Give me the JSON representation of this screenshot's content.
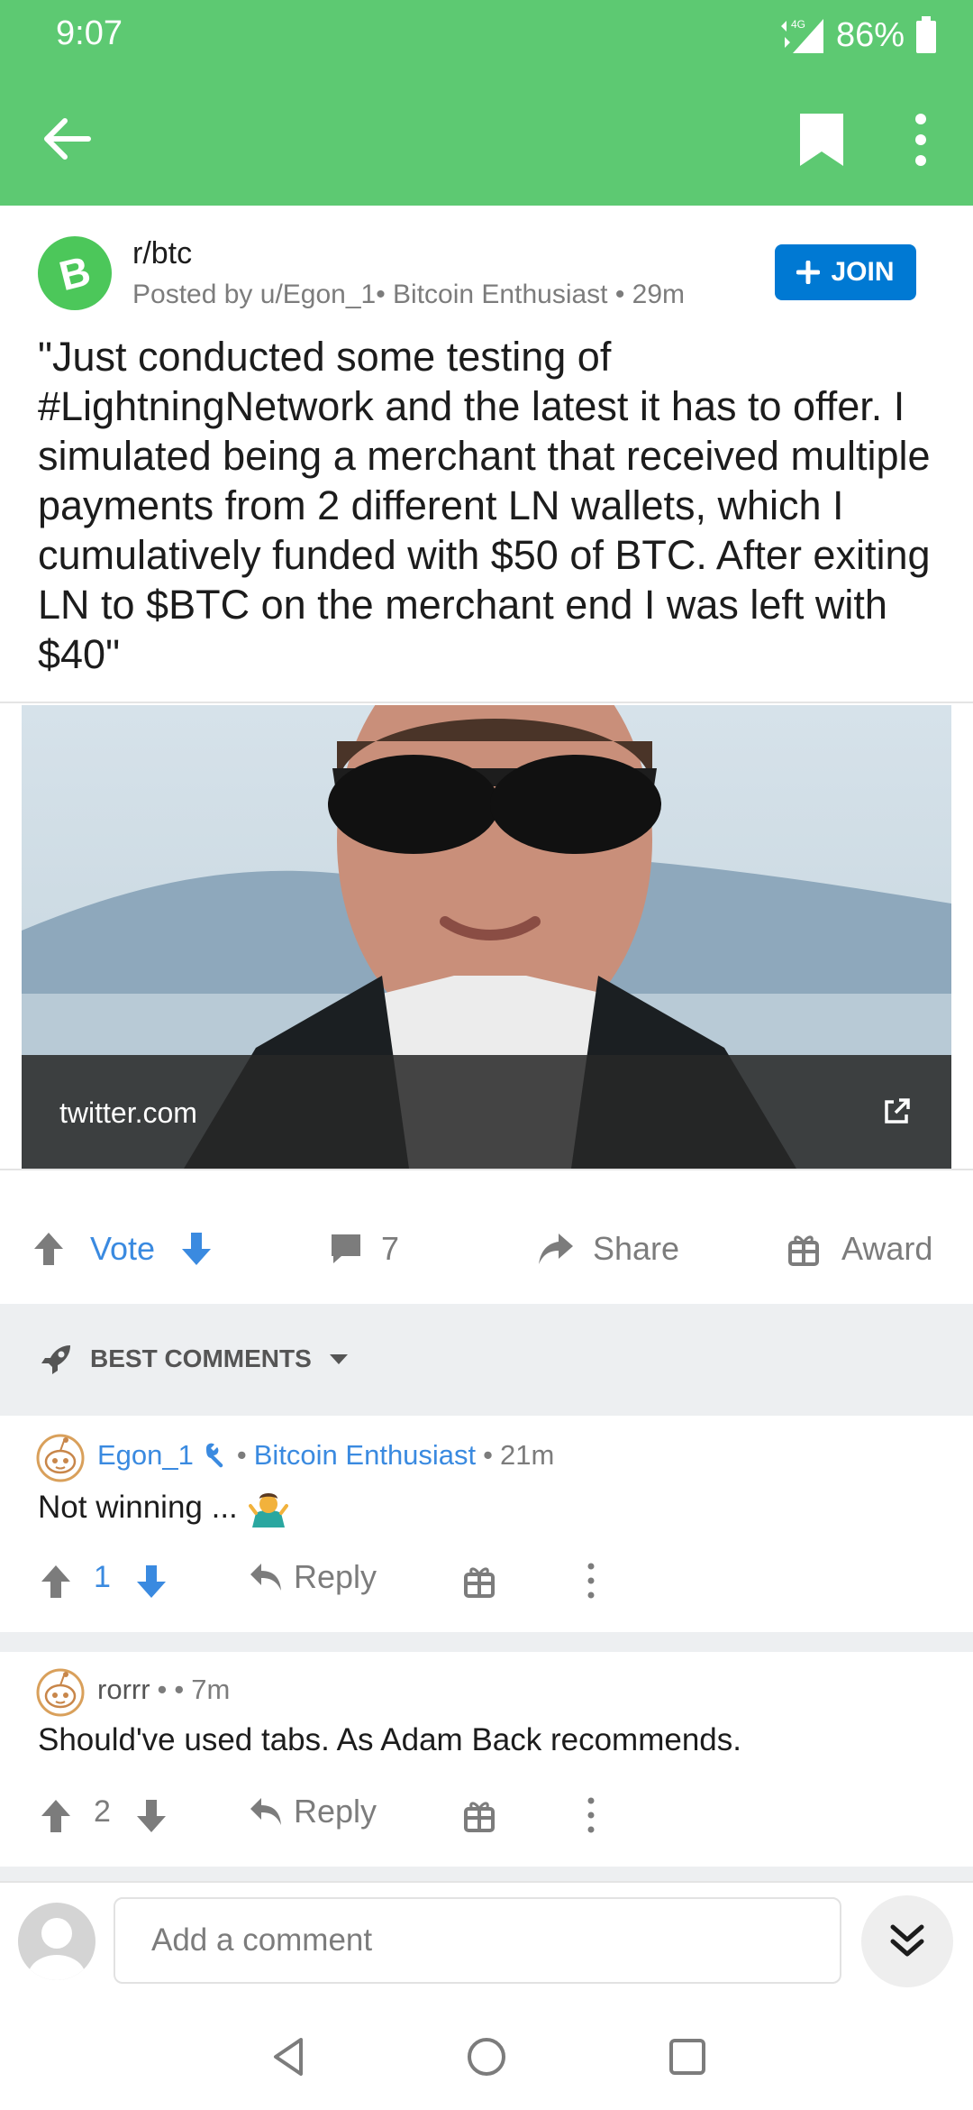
{
  "status": {
    "time": "9:07",
    "network": "4G",
    "battery": "86%"
  },
  "colors": {
    "app_green": "#5dc972",
    "join_blue": "#0079d3",
    "link_blue": "#3a8ae0"
  },
  "post": {
    "subreddit": "r/btc",
    "posted_by": "Posted by u/Egon_1• Bitcoin Enthusiast • 29m",
    "join_label": "JOIN",
    "title": "\"Just conducted some testing of #LightningNetwork and the latest it has to offer. I simulated being a merchant that received multiple payments from 2 different LN wallets, which I cumulatively funded with $50 of BTC. After exiting LN to $BTC on the merchant end I was left with $40\"",
    "link_domain": "twitter.com"
  },
  "actions": {
    "vote": "Vote",
    "comments": "7",
    "share": "Share",
    "award": "Award"
  },
  "sort": {
    "label": "BEST COMMENTS"
  },
  "comments": [
    {
      "author": "Egon_1",
      "flair": "Bitcoin Enthusiast",
      "age": "21m",
      "body": "Not winning ...",
      "score": "1",
      "reply": "Reply"
    },
    {
      "author": "rorrr",
      "age": "7m",
      "body": "Should've used tabs. As Adam Back recommends.",
      "score": "2",
      "reply": "Reply"
    }
  ],
  "composer": {
    "placeholder": "Add a comment"
  },
  "icons": [
    "back-arrow-icon",
    "bookmark-icon",
    "more-vert-icon",
    "bitcoin-cash-icon",
    "plus-icon",
    "external-link-icon",
    "upvote-icon",
    "downvote-icon",
    "comment-icon",
    "share-icon",
    "gift-icon",
    "rocket-icon",
    "caret-down-icon",
    "snoo-avatar-icon",
    "mod-wrench-icon",
    "shrug-emoji-icon",
    "reply-icon",
    "double-chevron-down-icon",
    "nav-back-icon",
    "nav-home-icon",
    "nav-recents-icon"
  ]
}
